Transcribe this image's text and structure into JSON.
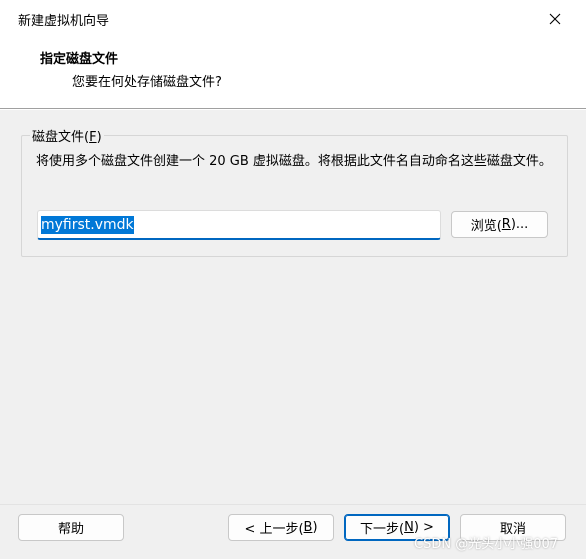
{
  "window": {
    "title": "新建虚拟机向导",
    "close_glyph": "✕"
  },
  "header": {
    "title": "指定磁盘文件",
    "subtitle": "您要在何处存储磁盘文件?"
  },
  "disk_group": {
    "legend_prefix": "磁盘文件(",
    "legend_accel": "F",
    "legend_suffix": ")",
    "description": "将使用多个磁盘文件创建一个 20 GB 虚拟磁盘。将根据此文件名自动命名这些磁盘文件。",
    "file_value": "myfirst.vmdk",
    "browse_prefix": "浏览(",
    "browse_accel": "R",
    "browse_suffix": ")..."
  },
  "footer": {
    "help_label": "帮助",
    "back_prefix": "< 上一步(",
    "back_accel": "B",
    "back_suffix": ")",
    "next_prefix": "下一步(",
    "next_accel": "N",
    "next_suffix": ") >",
    "cancel_label": "取消"
  },
  "watermark": "CSDN @光头小小强007",
  "colors": {
    "accent": "#0067c0",
    "selection": "#0078d7",
    "dialog_bg": "#f0f0f0"
  }
}
